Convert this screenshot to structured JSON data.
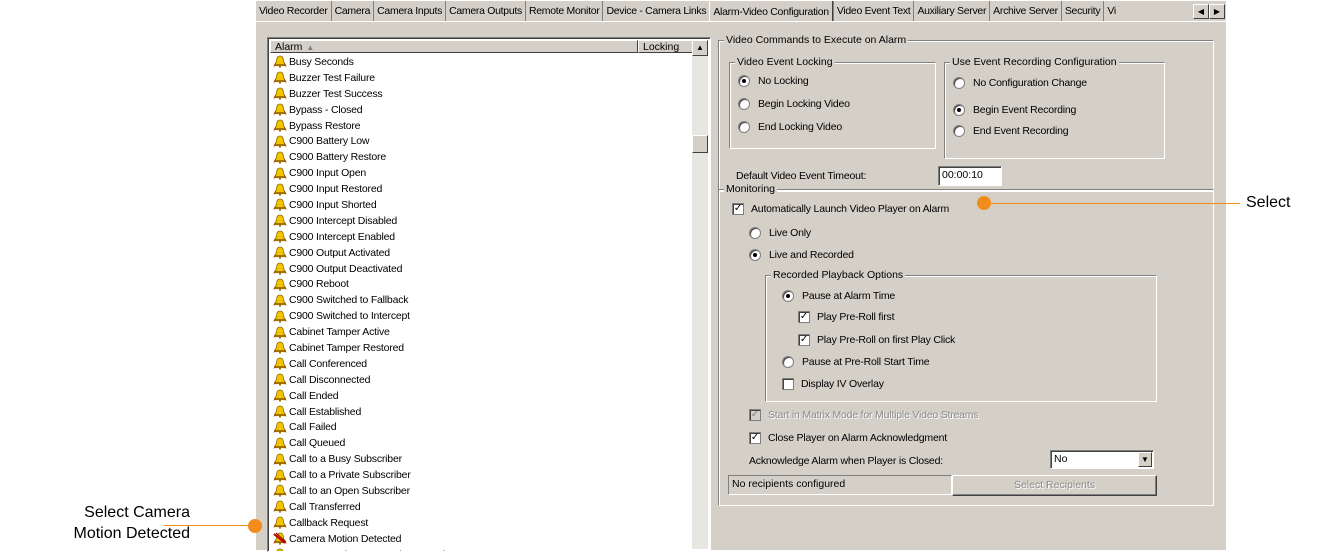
{
  "tabs": [
    {
      "label": "Video Recorder",
      "active": false
    },
    {
      "label": "Camera",
      "active": false
    },
    {
      "label": "Camera Inputs",
      "active": false
    },
    {
      "label": "Camera Outputs",
      "active": false
    },
    {
      "label": "Remote Monitor",
      "active": false
    },
    {
      "label": "Device - Camera Links",
      "active": false
    },
    {
      "label": "Alarm-Video Configuration",
      "active": true
    },
    {
      "label": "Video Event Text",
      "active": false
    },
    {
      "label": "Auxiliary Server",
      "active": false
    },
    {
      "label": "Archive Server",
      "active": false
    },
    {
      "label": "Security",
      "active": false
    },
    {
      "label": "Vi",
      "active": false
    }
  ],
  "alarm_list": {
    "col_alarm": "Alarm",
    "col_locking": "Locking",
    "items": [
      {
        "label": "Busy Seconds",
        "icon": "bell-icon"
      },
      {
        "label": "Buzzer Test Failure",
        "icon": "bell-icon"
      },
      {
        "label": "Buzzer Test Success",
        "icon": "bell-icon"
      },
      {
        "label": "Bypass - Closed",
        "icon": "bell-icon"
      },
      {
        "label": "Bypass Restore",
        "icon": "bell-icon"
      },
      {
        "label": "C900 Battery Low",
        "icon": "bell-icon"
      },
      {
        "label": "C900 Battery Restore",
        "icon": "bell-icon"
      },
      {
        "label": "C900 Input Open",
        "icon": "bell-icon"
      },
      {
        "label": "C900 Input Restored",
        "icon": "bell-icon"
      },
      {
        "label": "C900 Input Shorted",
        "icon": "bell-icon"
      },
      {
        "label": "C900 Intercept Disabled",
        "icon": "bell-icon"
      },
      {
        "label": "C900 Intercept Enabled",
        "icon": "bell-icon"
      },
      {
        "label": "C900 Output Activated",
        "icon": "bell-icon"
      },
      {
        "label": "C900 Output Deactivated",
        "icon": "bell-icon"
      },
      {
        "label": "C900 Reboot",
        "icon": "bell-icon"
      },
      {
        "label": "C900 Switched to Fallback",
        "icon": "bell-icon"
      },
      {
        "label": "C900 Switched to Intercept",
        "icon": "bell-icon"
      },
      {
        "label": "Cabinet Tamper Active",
        "icon": "bell-icon"
      },
      {
        "label": "Cabinet Tamper Restored",
        "icon": "bell-icon"
      },
      {
        "label": "Call Conferenced",
        "icon": "bell-icon"
      },
      {
        "label": "Call Disconnected",
        "icon": "bell-icon"
      },
      {
        "label": "Call Ended",
        "icon": "bell-icon"
      },
      {
        "label": "Call Established",
        "icon": "bell-icon"
      },
      {
        "label": "Call Failed",
        "icon": "bell-icon"
      },
      {
        "label": "Call Queued",
        "icon": "bell-icon"
      },
      {
        "label": "Call to a Busy Subscriber",
        "icon": "bell-icon"
      },
      {
        "label": "Call to a Private Subscriber",
        "icon": "bell-icon"
      },
      {
        "label": "Call to an Open Subscriber",
        "icon": "bell-icon"
      },
      {
        "label": "Call Transferred",
        "icon": "bell-icon"
      },
      {
        "label": "Callback Request",
        "icon": "bell-icon"
      },
      {
        "label": "Camera Motion Detected",
        "icon": "bell-video-icon"
      },
      {
        "label": "Camera Motion Detected Restored",
        "icon": "bell-icon"
      }
    ]
  },
  "video_commands": {
    "legend": "Video Commands to Execute on Alarm",
    "locking": {
      "legend": "Video Event Locking",
      "options": [
        "No Locking",
        "Begin Locking Video",
        "End Locking Video"
      ],
      "selected": "No Locking"
    },
    "recording": {
      "legend": "Use Event Recording Configuration",
      "options": [
        "No Configuration Change",
        "Begin Event Recording",
        "End Event Recording"
      ],
      "selected": "Begin Event Recording"
    },
    "timeout_label": "Default Video Event Timeout:",
    "timeout_value": "00:00:10"
  },
  "monitoring": {
    "legend": "Monitoring",
    "auto_launch": {
      "label": "Automatically Launch Video Player on Alarm",
      "checked": true
    },
    "mode_options": [
      "Live Only",
      "Live and Recorded"
    ],
    "mode_selected": "Live and Recorded",
    "playback": {
      "legend": "Recorded Playback Options",
      "pause_alarm": "Pause at Alarm Time",
      "play_preroll_first": {
        "label": "Play Pre-Roll first",
        "checked": true
      },
      "play_preroll_click": {
        "label": "Play Pre-Roll on first Play Click",
        "checked": true
      },
      "pause_preroll": "Pause at Pre-Roll Start Time",
      "display_iv": {
        "label": "Display IV Overlay",
        "checked": false
      },
      "selected": "Pause at Alarm Time"
    },
    "matrix_mode": {
      "label": "Start in Matrix Mode for Multiple Video Streams",
      "checked": true,
      "disabled": true
    },
    "close_player": {
      "label": "Close Player on Alarm Acknowledgment",
      "checked": true
    },
    "ack_label": "Acknowledge Alarm when Player is Closed:",
    "ack_value": "No",
    "recipients_text": "No recipients configured",
    "select_recipients": "Select Recipients"
  },
  "callouts": {
    "select": "Select",
    "select_camera": "Select Camera\nMotion Detected"
  },
  "colors": {
    "accent": "#f28c1a",
    "dialog_bg": "#d4d0c8"
  }
}
